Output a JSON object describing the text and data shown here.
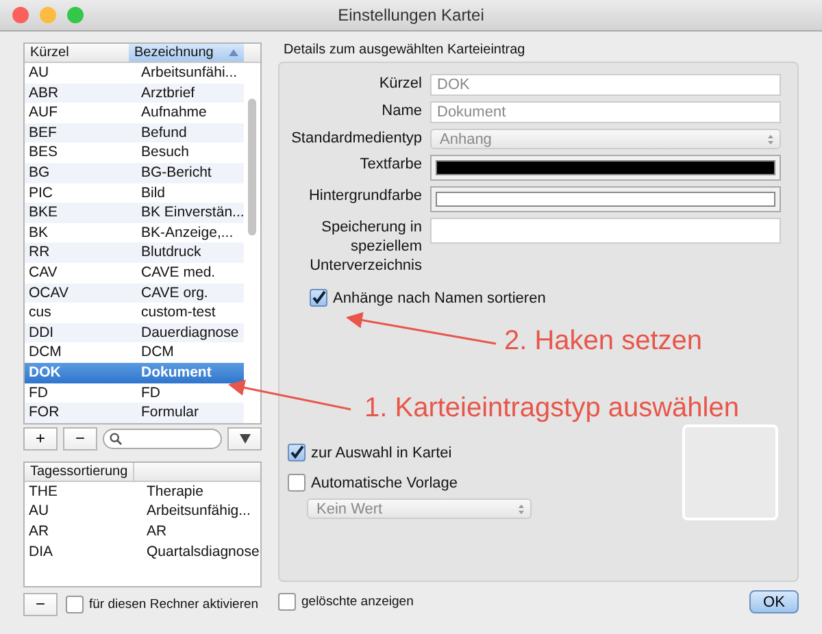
{
  "window": {
    "title": "Einstellungen Kartei"
  },
  "kartei_table": {
    "columns": [
      {
        "label": "Kürzel",
        "sorted": false
      },
      {
        "label": "Bezeichnung",
        "sorted": true
      }
    ],
    "rows": [
      {
        "kuerzel": "AU",
        "bezeichnung": "Arbeitsunfähi...",
        "selected": false
      },
      {
        "kuerzel": "ABR",
        "bezeichnung": "Arztbrief",
        "selected": false
      },
      {
        "kuerzel": "AUF",
        "bezeichnung": "Aufnahme",
        "selected": false
      },
      {
        "kuerzel": "BEF",
        "bezeichnung": "Befund",
        "selected": false
      },
      {
        "kuerzel": "BES",
        "bezeichnung": "Besuch",
        "selected": false
      },
      {
        "kuerzel": "BG",
        "bezeichnung": "BG-Bericht",
        "selected": false
      },
      {
        "kuerzel": "PIC",
        "bezeichnung": "Bild",
        "selected": false
      },
      {
        "kuerzel": "BKE",
        "bezeichnung": "BK Einverstän...",
        "selected": false
      },
      {
        "kuerzel": "BK",
        "bezeichnung": "BK-Anzeige,...",
        "selected": false
      },
      {
        "kuerzel": "RR",
        "bezeichnung": "Blutdruck",
        "selected": false
      },
      {
        "kuerzel": "CAV",
        "bezeichnung": "CAVE med.",
        "selected": false
      },
      {
        "kuerzel": "OCAV",
        "bezeichnung": "CAVE org.",
        "selected": false
      },
      {
        "kuerzel": "cus",
        "bezeichnung": "custom-test",
        "selected": false
      },
      {
        "kuerzel": "DDI",
        "bezeichnung": "Dauerdiagnose",
        "selected": false
      },
      {
        "kuerzel": "DCM",
        "bezeichnung": "DCM",
        "selected": false
      },
      {
        "kuerzel": "DOK",
        "bezeichnung": "Dokument",
        "selected": true
      },
      {
        "kuerzel": "FD",
        "bezeichnung": "FD",
        "selected": false
      },
      {
        "kuerzel": "FOR",
        "bezeichnung": "Formular",
        "selected": false
      }
    ]
  },
  "kartei_toolbar": {
    "add": "+",
    "remove": "−"
  },
  "day_table": {
    "column": "Tagessortierung",
    "rows": [
      {
        "kuerzel": "THE",
        "bezeichnung": "Therapie"
      },
      {
        "kuerzel": "AU",
        "bezeichnung": "Arbeitsunfähig..."
      },
      {
        "kuerzel": "AR",
        "bezeichnung": "AR"
      },
      {
        "kuerzel": "DIA",
        "bezeichnung": "Quartalsdiagnose"
      }
    ]
  },
  "day_toolbar": {
    "remove": "−",
    "checkbox": {
      "label": "für diesen Rechner aktivieren",
      "checked": false
    }
  },
  "details": {
    "title": "Details zum ausgewählten Karteieintrag",
    "fields": [
      {
        "kind": "text",
        "label": "Kürzel",
        "value": "DOK"
      },
      {
        "kind": "text",
        "label": "Name",
        "value": "Dokument"
      },
      {
        "kind": "select",
        "label": "Standardmedientyp",
        "value": "Anhang"
      },
      {
        "kind": "color",
        "label": "Textfarbe",
        "color": "#000000"
      },
      {
        "kind": "color",
        "label": "Hintergrundfarbe",
        "color": "#ffffff"
      },
      {
        "kind": "text",
        "label": "Speicherung in speziellem Unterverzeichnis"
      }
    ],
    "sort_checkbox": {
      "label": "Anhänge nach Namen sortieren",
      "checked": true
    },
    "selection_checkbox": {
      "label": "zur Auswahl in Kartei",
      "checked": true
    },
    "template_checkbox": {
      "label": "Automatische Vorlage",
      "checked": false
    },
    "template_select": {
      "value": "Kein Wert"
    }
  },
  "footer": {
    "deleted_checkbox": {
      "label": "gelöschte anzeigen",
      "checked": false
    },
    "ok": "OK"
  },
  "annotations": [
    {
      "text": "2. Haken setzen"
    },
    {
      "text": "1. Karteieintragstyp auswählen"
    }
  ]
}
